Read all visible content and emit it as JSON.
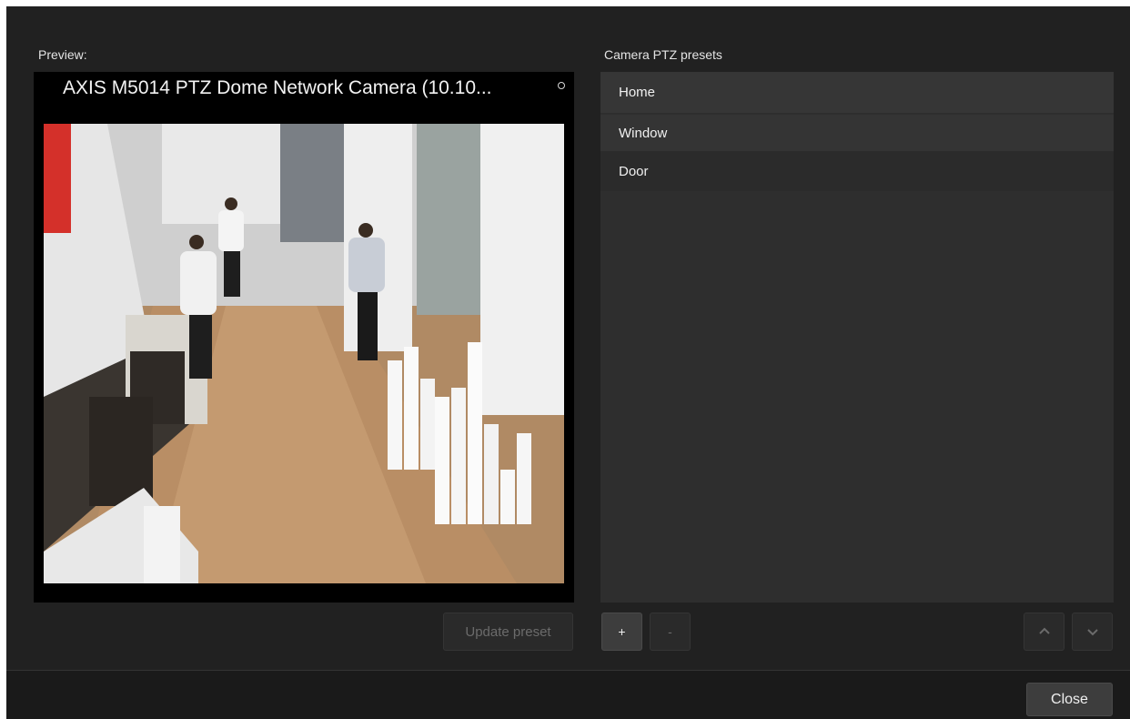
{
  "preview": {
    "label": "Preview:",
    "camera_title": "AXIS M5014 PTZ Dome Network Camera (10.10..."
  },
  "presets": {
    "label": "Camera PTZ presets",
    "items": [
      "Home",
      "Window",
      "Door"
    ]
  },
  "buttons": {
    "update_preset": "Update preset",
    "add": "+",
    "remove": "-",
    "close": "Close"
  },
  "icons": {
    "move_up": "chevron-up-icon",
    "move_down": "chevron-down-icon",
    "status": "status-dot-icon"
  },
  "colors": {
    "background": "#212121",
    "list_background": "#2e2e2e",
    "selected_row": "#363636"
  }
}
